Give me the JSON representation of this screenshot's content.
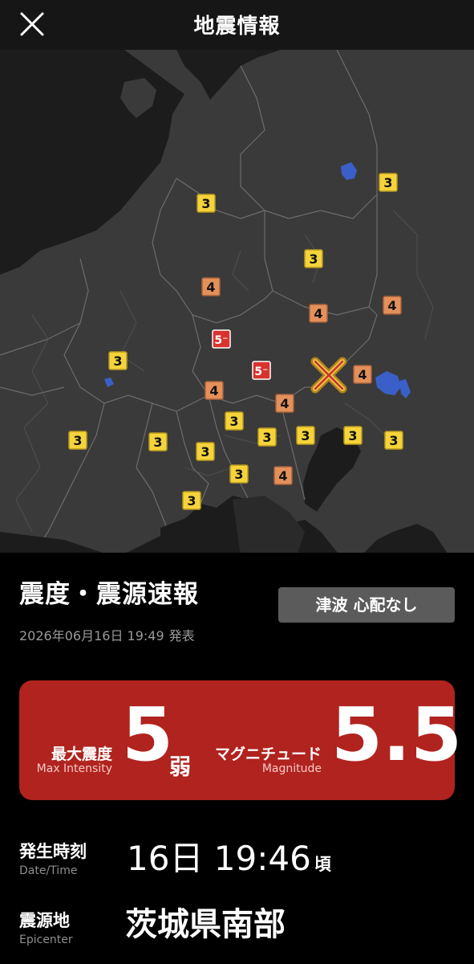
{
  "header": {
    "title": "地震情報",
    "close_icon": "close-icon"
  },
  "map": {
    "intensity_markers": [
      {
        "label": "3",
        "level": "3"
      },
      {
        "label": "3",
        "level": "3"
      },
      {
        "label": "3",
        "level": "3"
      },
      {
        "label": "4",
        "level": "4"
      },
      {
        "label": "4",
        "level": "4"
      },
      {
        "label": "4",
        "level": "4"
      },
      {
        "label": "5⁻",
        "level": "5-"
      },
      {
        "label": "3",
        "level": "3"
      },
      {
        "label": "5⁻",
        "level": "5-"
      },
      {
        "label": "4",
        "level": "4"
      },
      {
        "label": "4",
        "level": "4"
      },
      {
        "label": "4",
        "level": "4"
      },
      {
        "label": "3",
        "level": "3"
      },
      {
        "label": "3",
        "level": "3"
      },
      {
        "label": "3",
        "level": "3"
      },
      {
        "label": "3",
        "level": "3"
      },
      {
        "label": "3",
        "level": "3"
      },
      {
        "label": "3",
        "level": "3"
      },
      {
        "label": "3",
        "level": "3"
      },
      {
        "label": "3",
        "level": "3"
      },
      {
        "label": "3",
        "level": "3"
      },
      {
        "label": "4",
        "level": "4"
      },
      {
        "label": "3",
        "level": "3"
      }
    ],
    "epicenter_icon": "epicenter-cross-icon",
    "colors": {
      "level3": "#f5d33a",
      "level4": "#e3905b",
      "level5": "#d8332e",
      "land": "#3a3a3a",
      "sea": "#1c1c1c",
      "lake": "#3a5fc8"
    }
  },
  "report": {
    "title": "震度・震源速報",
    "tsunami": "津波 心配なし",
    "published_time": "2026年06月16日 19:49",
    "published_suffix": "発表"
  },
  "summary": {
    "max_intensity_label": "最大震度",
    "max_intensity_sub": "Max Intensity",
    "max_intensity_value": "5",
    "max_intensity_suffix": "弱",
    "magnitude_label": "マグニチュード",
    "magnitude_sub": "Magnitude",
    "magnitude_value": "5.5",
    "card_color": "#b1231e"
  },
  "details": {
    "datetime_label": "発生時刻",
    "datetime_sub": "Date/Time",
    "datetime_value": "16日 19:46",
    "datetime_suffix": "頃",
    "epicenter_label": "震源地",
    "epicenter_sub": "Epicenter",
    "epicenter_value": "茨城県南部"
  }
}
